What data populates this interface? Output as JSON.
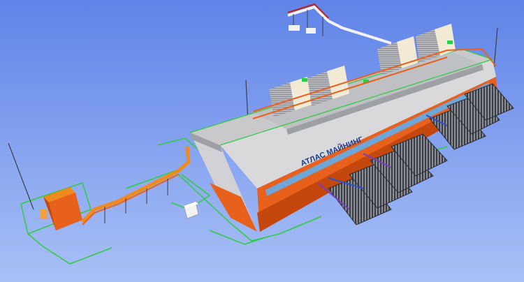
{
  "scene": {
    "background_top": "#5f83e8",
    "background_bottom": "#a9c0f6",
    "building_sign": "АТЛАС МАЙНИНГ",
    "colors": {
      "orange": "#e8611c",
      "orange_dark": "#c4470e",
      "wall": "#d9d9dc",
      "roof": "#c9c9cc",
      "roof_dark": "#9fa0a5",
      "green_line": "#2ecc40",
      "pipe_orange": "#f08a1c",
      "pipe_white": "#f2f2f2",
      "pipe_red": "#c0201a",
      "cooler_grey": "#8a8d94",
      "cooler_dark": "#3b3e47",
      "unit_cream": "#f3ead6",
      "unit_grey": "#b7b8bd"
    }
  }
}
